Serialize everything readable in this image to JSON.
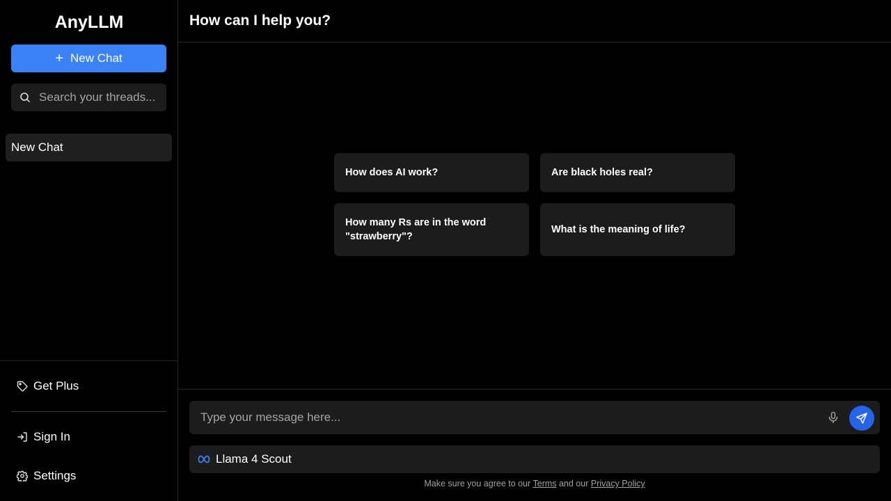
{
  "app": {
    "title": "AnyLLM"
  },
  "sidebar": {
    "new_chat_label": "New Chat",
    "search_placeholder": "Search your threads...",
    "threads": [
      {
        "label": "New Chat"
      }
    ],
    "bottom": {
      "get_plus": "Get Plus",
      "sign_in": "Sign In",
      "settings": "Settings"
    }
  },
  "header": {
    "title": "How can I help you?"
  },
  "suggestions": [
    "How does AI work?",
    "Are black holes real?",
    "How many Rs are in the word \"strawberry\"?",
    "What is the meaning of life?"
  ],
  "composer": {
    "placeholder": "Type your message here..."
  },
  "model": {
    "name": "Llama 4 Scout",
    "icon": "meta-icon"
  },
  "footer": {
    "prefix": "Make sure you agree to our ",
    "terms": "Terms",
    "middle": " and our ",
    "privacy": "Privacy Policy"
  },
  "colors": {
    "accent": "#3b82f6",
    "send": "#2563eb",
    "background": "#000000",
    "surface": "#1c1c1c"
  }
}
